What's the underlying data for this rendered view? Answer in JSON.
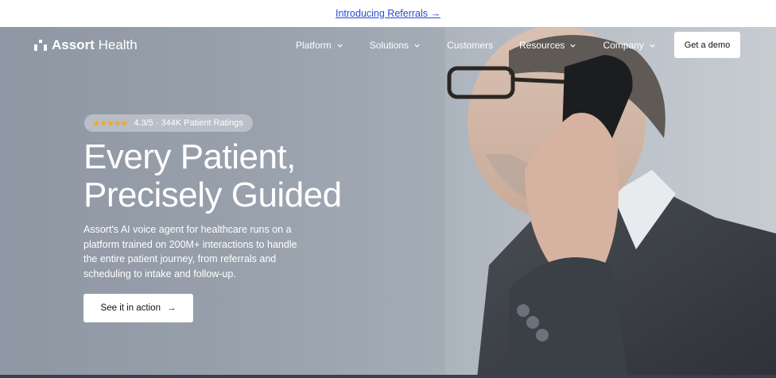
{
  "announcement": {
    "label": "Introducing Referrals →"
  },
  "brand": {
    "name_bold": "Assort",
    "name_light": " Health"
  },
  "nav": {
    "items": [
      {
        "label": "Platform",
        "has_dropdown": true
      },
      {
        "label": "Solutions",
        "has_dropdown": true
      },
      {
        "label": "Customers",
        "has_dropdown": false
      },
      {
        "label": "Resources",
        "has_dropdown": true
      },
      {
        "label": "Company",
        "has_dropdown": true
      }
    ],
    "cta_label": "Get a demo"
  },
  "hero": {
    "rating_stars": "★★★★★",
    "rating_text": "4.3/5 · 344K  Patient Ratings",
    "headline_line1": "Every Patient,",
    "headline_line2": "Precisely Guided",
    "subtext": "Assort's AI voice agent for healthcare runs on a platform trained on 200M+ interactions to handle the entire patient journey, from referrals and scheduling to intake and follow-up.",
    "cta_label": "See it in action",
    "cta_arrow": "→"
  },
  "colors": {
    "link": "#2a4bd3",
    "star": "#f5a623",
    "text_on_hero": "#ffffff"
  },
  "icons": [
    "logo-mark-icon",
    "chevron-down-icon",
    "arrow-right-icon",
    "star-icon"
  ]
}
